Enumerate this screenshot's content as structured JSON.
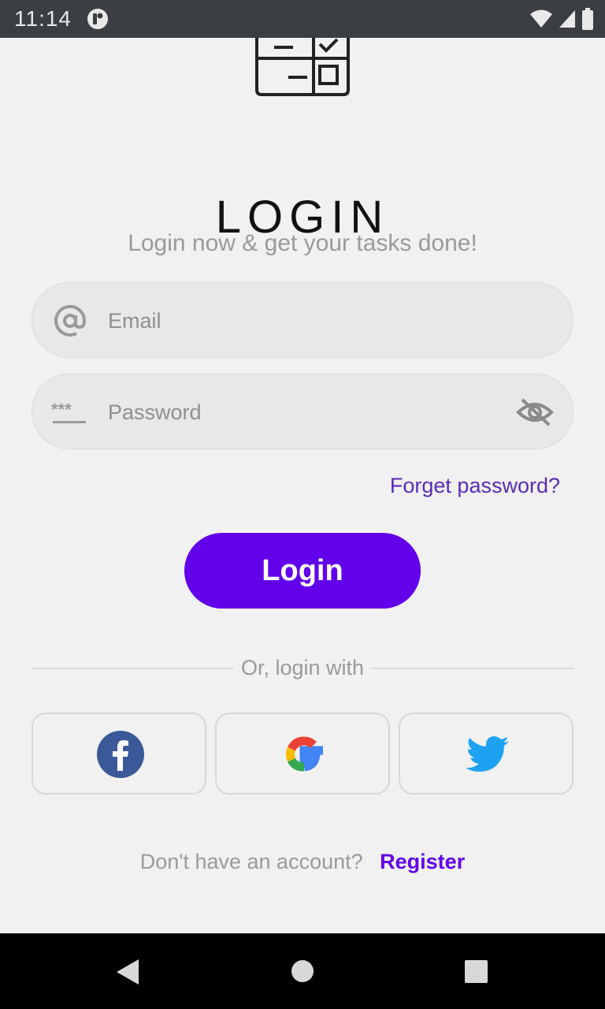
{
  "status_bar": {
    "time": "11:14"
  },
  "header": {
    "title": "LOGIN",
    "subtitle": "Login now & get your tasks done!"
  },
  "form": {
    "email_placeholder": "Email",
    "password_placeholder": "Password",
    "forgot_label": "Forget password?",
    "login_label": "Login"
  },
  "social": {
    "divider_label": "Or, login with",
    "buttons": [
      {
        "name": "facebook",
        "icon": "facebook-icon",
        "color": "#3b5998"
      },
      {
        "name": "google",
        "icon": "google-icon",
        "color": "#4285f4"
      },
      {
        "name": "twitter",
        "icon": "twitter-icon",
        "color": "#1da1f2"
      }
    ]
  },
  "footer": {
    "question": "Don't have an account?",
    "register_label": "Register"
  },
  "colors": {
    "accent": "#6200ea",
    "link": "#5a2bb5"
  }
}
